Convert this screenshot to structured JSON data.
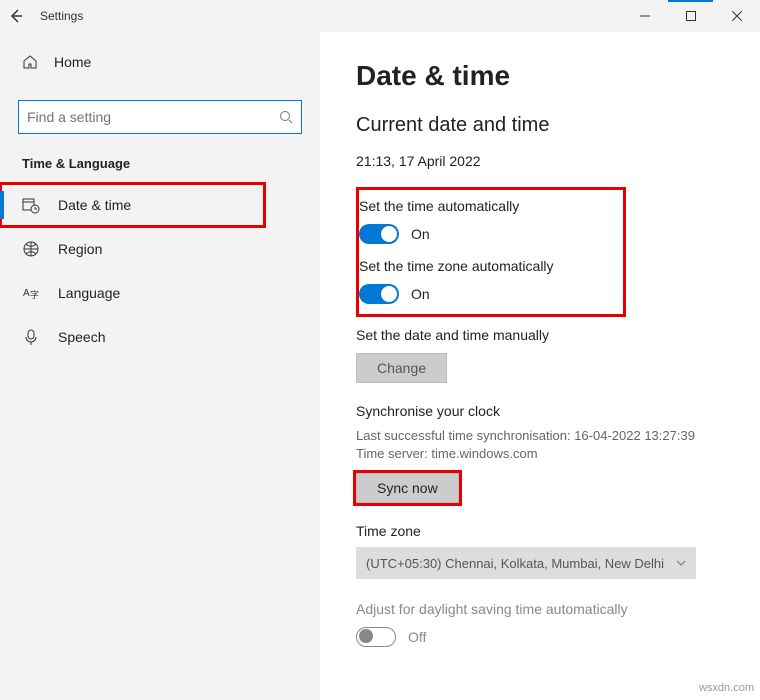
{
  "window": {
    "title": "Settings"
  },
  "sidebar": {
    "home_label": "Home",
    "search_placeholder": "Find a setting",
    "category_label": "Time & Language",
    "items": [
      {
        "label": "Date & time"
      },
      {
        "label": "Region"
      },
      {
        "label": "Language"
      },
      {
        "label": "Speech"
      }
    ]
  },
  "main": {
    "heading": "Date & time",
    "subheading": "Current date and time",
    "current_datetime": "21:13, 17 April 2022",
    "auto_time": {
      "label": "Set the time automatically",
      "state": "On"
    },
    "auto_tz": {
      "label": "Set the time zone automatically",
      "state": "On"
    },
    "manual": {
      "label": "Set the date and time manually",
      "button": "Change"
    },
    "sync": {
      "heading": "Synchronise your clock",
      "last_label": "Last successful time synchronisation: 16-04-2022 13:27:39",
      "server_label": "Time server: time.windows.com",
      "button": "Sync now"
    },
    "timezone": {
      "heading": "Time zone",
      "value": "(UTC+05:30) Chennai, Kolkata, Mumbai, New Delhi"
    },
    "dst": {
      "label": "Adjust for daylight saving time automatically",
      "state": "Off"
    }
  },
  "watermark": "wsxdn.com"
}
